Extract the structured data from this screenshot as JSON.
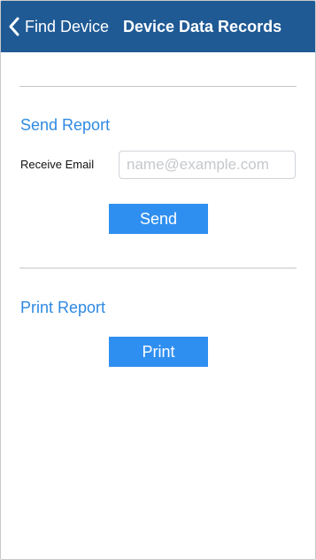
{
  "navbar": {
    "back_label": "Find Device",
    "title": "Device Data Records",
    "back_icon": "chevron-left-icon"
  },
  "send_report": {
    "title": "Send Report",
    "email_label": "Receive Email",
    "email_placeholder": "name@example.com",
    "email_value": "",
    "button_label": "Send"
  },
  "print_report": {
    "title": "Print Report",
    "button_label": "Print"
  },
  "colors": {
    "navbar_bg": "#1f5a95",
    "accent": "#2f8ae2",
    "button_bg": "#2f8ff0"
  }
}
